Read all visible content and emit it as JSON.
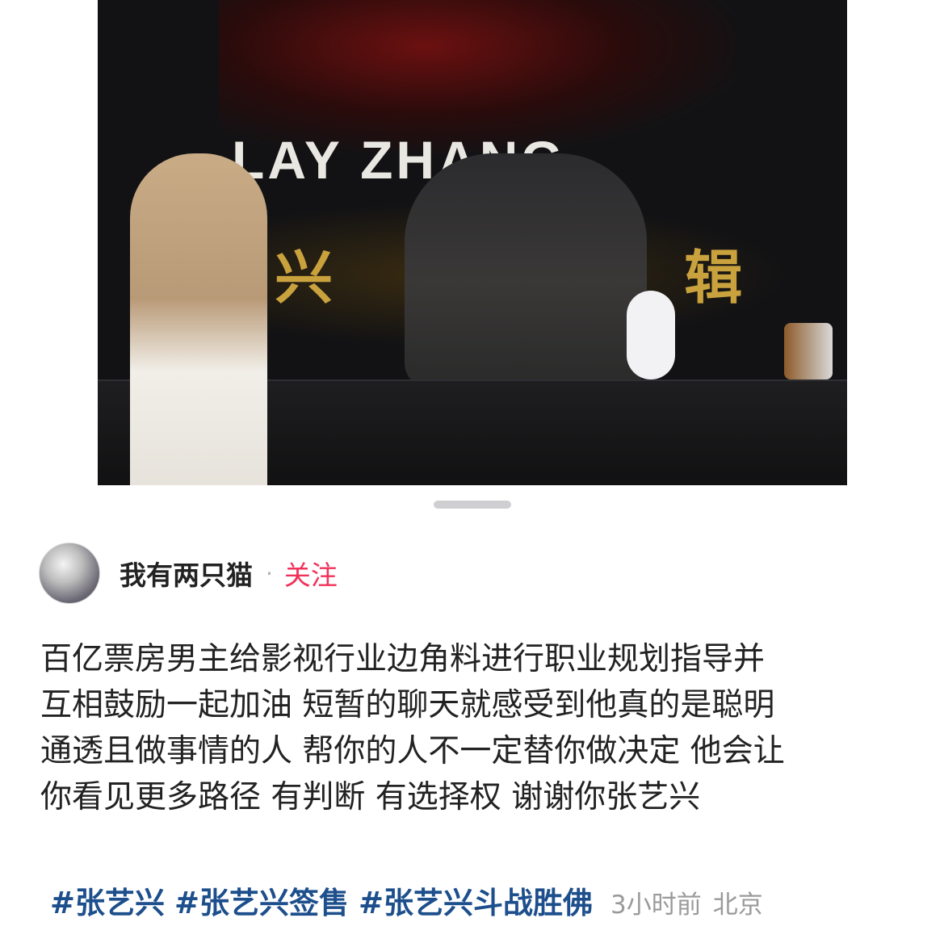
{
  "photo": {
    "backdrop_brand": "LAY ZHANG",
    "backdrop_banner": "张 兴 实 专 辑"
  },
  "toolbar": {
    "search_icon": "search-icon"
  },
  "post": {
    "author": {
      "name": "我有两只猫",
      "separator": "·",
      "follow_label": "关注"
    },
    "body": "百亿票房男主给影视行业边角料进行职业规划指导并\n互相鼓励一起加油 短暂的聊天就感受到他真的是聪明\n通透且做事情的人 帮你的人不一定替你做决定 他会让\n你看见更多路径 有判断 有选择权 谢谢你张艺兴",
    "hashtags": [
      "#张艺兴",
      "#张艺兴签售",
      "#张艺兴斗战胜佛"
    ],
    "time": "3小时前",
    "location": "北京"
  },
  "colors": {
    "accent_follow": "#f0325b",
    "hashtag": "#1d4f8c",
    "meta": "#9a9a9a"
  }
}
